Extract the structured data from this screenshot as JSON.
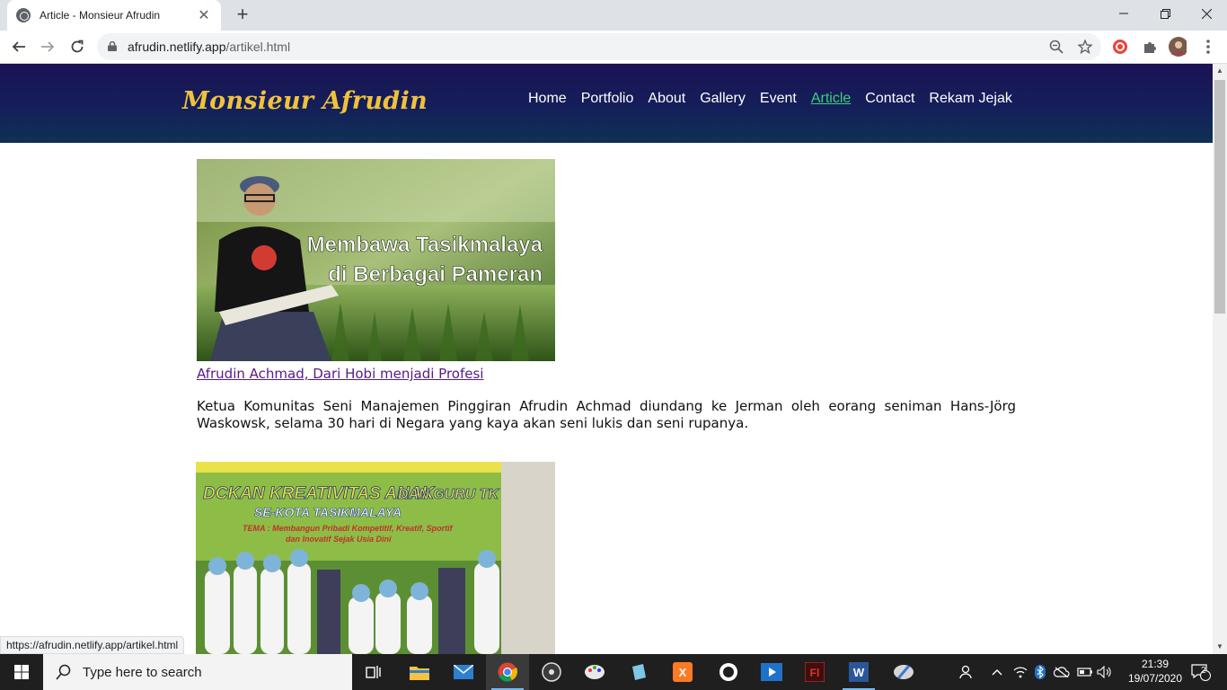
{
  "browser": {
    "tab_title": "Article - Monsieur Afrudin",
    "url_host": "afrudin.netlify.app",
    "url_path": "/artikel.html",
    "status_url": "https://afrudin.netlify.app/artikel.html"
  },
  "site": {
    "brand": "Monsieur Afrudin",
    "nav": [
      "Home",
      "Portfolio",
      "About",
      "Gallery",
      "Event",
      "Article",
      "Contact",
      "Rekam Jejak"
    ],
    "active_nav": "Article"
  },
  "articles": [
    {
      "image_text": [
        "Membawa Tasikmalaya",
        "di Berbagai Pameran"
      ],
      "link": "Afrudin Achmad, Dari Hobi menjadi Profesi",
      "summary": "Ketua Komunitas Seni Manajemen Pinggiran Afrudin Achmad diundang ke Jerman oleh eorang seniman Hans-Jörg Waskowsk, selama 30 hari di Negara yang kaya akan seni lukis dan seni rupanya."
    },
    {
      "image_text": [
        "DAN GURU TK",
        "SE-KOTA TASIKMALAYA",
        "TEMA : Membangun Pribadi Kompetitif, Kreatif, Sportif",
        "dan Inovatif Sejak Usia Dini"
      ]
    }
  ],
  "taskbar": {
    "search_placeholder": "Type here to search",
    "time": "21:39",
    "date": "19/07/2020",
    "notification_count": "2"
  }
}
